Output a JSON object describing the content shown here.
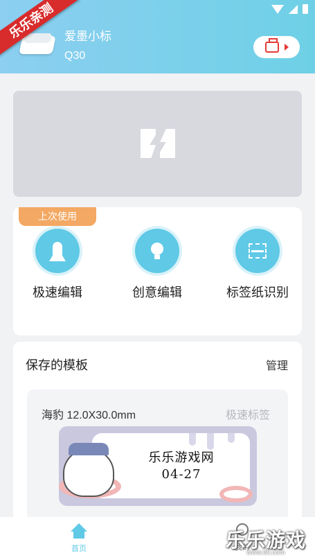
{
  "header": {
    "corner_ribbon": "乐乐亲测",
    "device_name": "爱墨小标",
    "device_model": "Q30"
  },
  "tools": {
    "badge": "上次使用",
    "items": [
      {
        "label": "极速编辑",
        "icon": "rocket-icon"
      },
      {
        "label": "创意编辑",
        "icon": "lightbulb-icon"
      },
      {
        "label": "标签纸识别",
        "icon": "scan-icon"
      }
    ]
  },
  "templates": {
    "title": "保存的模板",
    "manage": "管理",
    "item": {
      "name": "海豹 12.0X30.0mm",
      "type": "极速标签",
      "label_text_line1": "乐乐游戏网",
      "label_text_line2": "04-27"
    }
  },
  "bottom_nav": {
    "home": "首页",
    "me": "我的"
  },
  "watermark": {
    "text": "乐乐游戏",
    "url": "www.6ll.com"
  },
  "colors": {
    "accent": "#5fc9e6",
    "badge": "#f3a863",
    "print": "#e53935"
  }
}
